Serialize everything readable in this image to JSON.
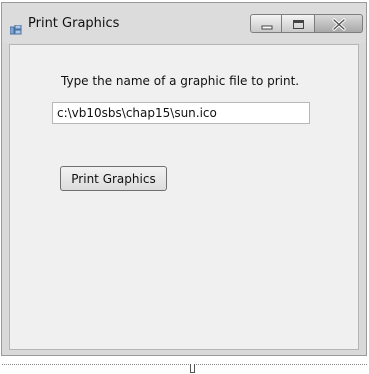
{
  "window": {
    "title": "Print Graphics",
    "icon": "form-icon"
  },
  "caption_buttons": {
    "minimize_icon": "minimize-icon",
    "maximize_icon": "maximize-icon",
    "close_icon": "close-icon"
  },
  "form": {
    "prompt_label": "Type the name of a graphic file to print.",
    "file_value": "c:\\vb10sbs\\chap15\\sun.ico",
    "print_button_label": "Print Graphics"
  }
}
